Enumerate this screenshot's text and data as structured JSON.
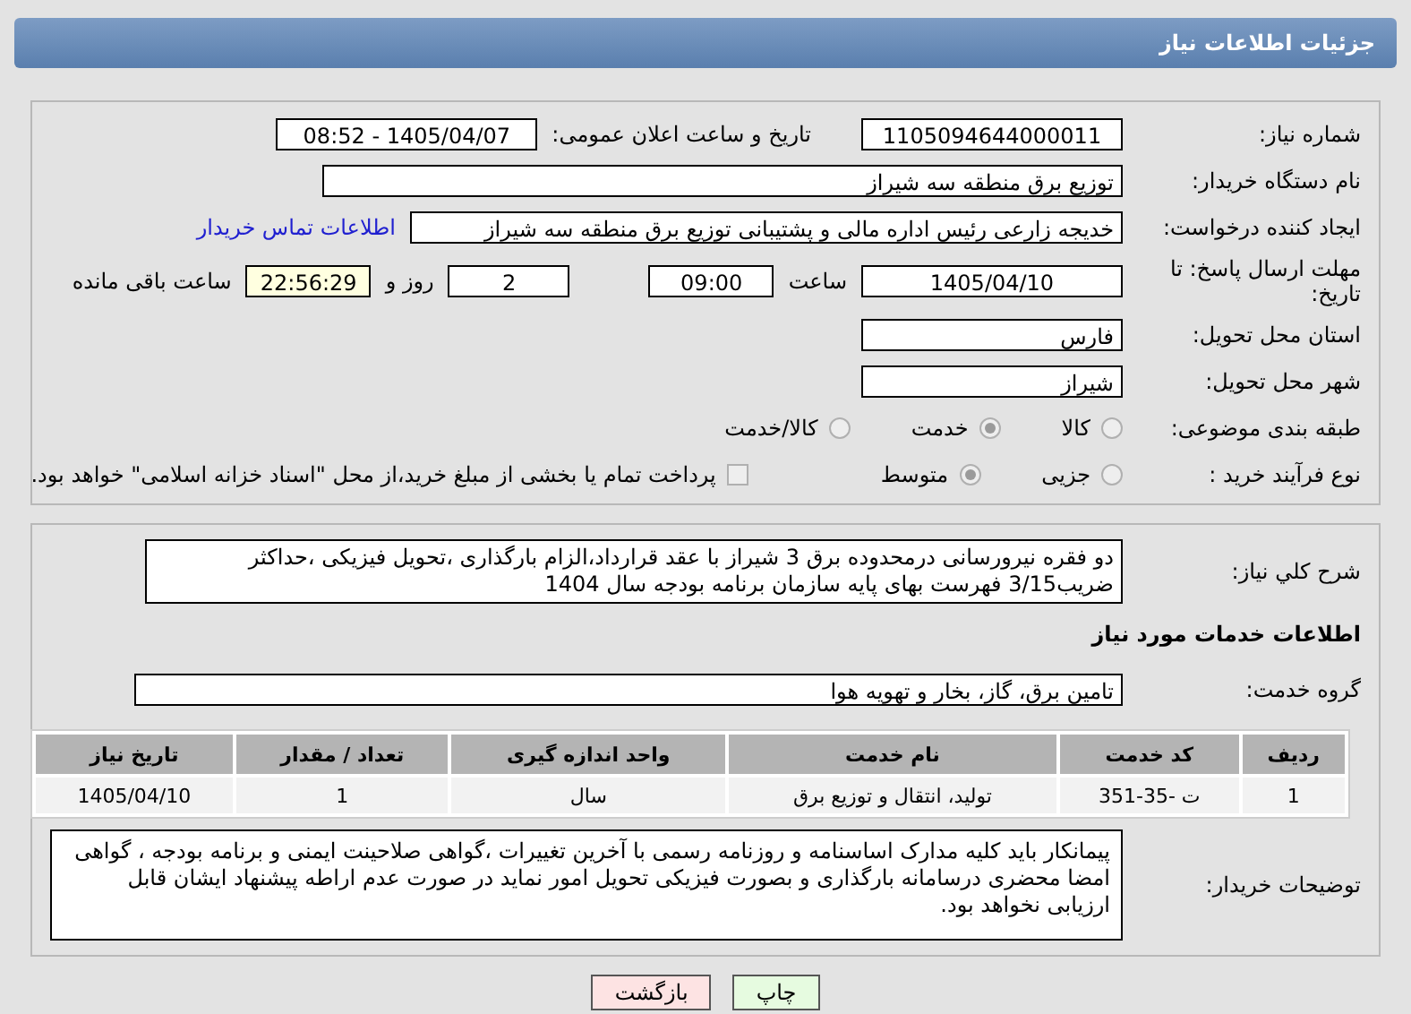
{
  "title": "جزئیات اطلاعات نیاز",
  "need_number": {
    "label": "شماره نیاز:",
    "value": "1105094644000011"
  },
  "announce": {
    "label": "تاریخ و ساعت اعلان عمومی:",
    "value": "1405/04/07 - 08:52"
  },
  "buyer_org": {
    "label": "نام دستگاه خریدار:",
    "value": "توزیع برق منطقه سه شیراز"
  },
  "requester": {
    "label": "ایجاد کننده درخواست:",
    "value": "خدیجه زارعی رئیس اداره مالی و پشتیبانی توزیع برق منطقه سه شیراز",
    "link": "اطلاعات تماس خریدار"
  },
  "deadline": {
    "label": "مهلت ارسال پاسخ: تا تاریخ:",
    "date": "1405/04/10",
    "time_label": "ساعت",
    "time": "09:00",
    "days": "2",
    "days_label": "روز و",
    "remaining": "22:56:29",
    "remaining_label": "ساعت باقی مانده"
  },
  "province": {
    "label": "استان محل تحویل:",
    "value": "فارس"
  },
  "city": {
    "label": "شهر محل تحویل:",
    "value": "شیراز"
  },
  "category": {
    "label": "طبقه بندی موضوعی:",
    "options": [
      {
        "label": "کالا",
        "selected": false
      },
      {
        "label": "خدمت",
        "selected": true
      },
      {
        "label": "کالا/خدمت",
        "selected": false
      }
    ]
  },
  "purchase_type": {
    "label": "نوع فرآیند خرید :",
    "options": [
      {
        "label": "جزیی",
        "selected": false
      },
      {
        "label": "متوسط",
        "selected": true
      }
    ],
    "payment": {
      "checked": false,
      "text": "پرداخت تمام یا بخشی از مبلغ خرید،از محل \"اسناد خزانه اسلامی\" خواهد بود."
    }
  },
  "description": {
    "label": "شرح کلي نياز:",
    "value": "دو فقره  نیرورسانی درمحدوده برق 3 شیراز با عقد قرارداد،الزام بارگذاری ،تحویل فیزیکی ،حداکثر ضریب3/15 فهرست بهای  پایه سازمان برنامه بودجه سال 1404"
  },
  "services_heading": "اطلاعات خدمات مورد نیاز",
  "service_group": {
    "label": "گروه خدمت:",
    "value": "تامین برق، گاز، بخار و تهویه هوا"
  },
  "table": {
    "columns": [
      "ردیف",
      "کد خدمت",
      "نام خدمت",
      "واحد اندازه گیری",
      "تعداد / مقدار",
      "تاریخ نیاز"
    ],
    "rows": [
      [
        "1",
        "ت -35-351",
        "تولید، انتقال و توزیع برق",
        "سال",
        "1",
        "1405/04/10"
      ]
    ]
  },
  "buyer_notes": {
    "label": "توضیحات خریدار:",
    "value": "پیمانکار باید کلیه مدارک اساسنامه و روزنامه رسمی با آخرین تغییرات ،گواهی صلاحینت ایمنی و برنامه بودجه ، گواهی امضا محضری درسامانه بارگذاری و بصورت فیزیکی تحویل امور نماید در صورت عدم اراطه پیشنهاد ایشان قابل ارزیابی نخواهد بود."
  },
  "buttons": [
    {
      "label": "چاپ",
      "kind": "print"
    },
    {
      "label": "بازگشت",
      "kind": "back"
    }
  ]
}
